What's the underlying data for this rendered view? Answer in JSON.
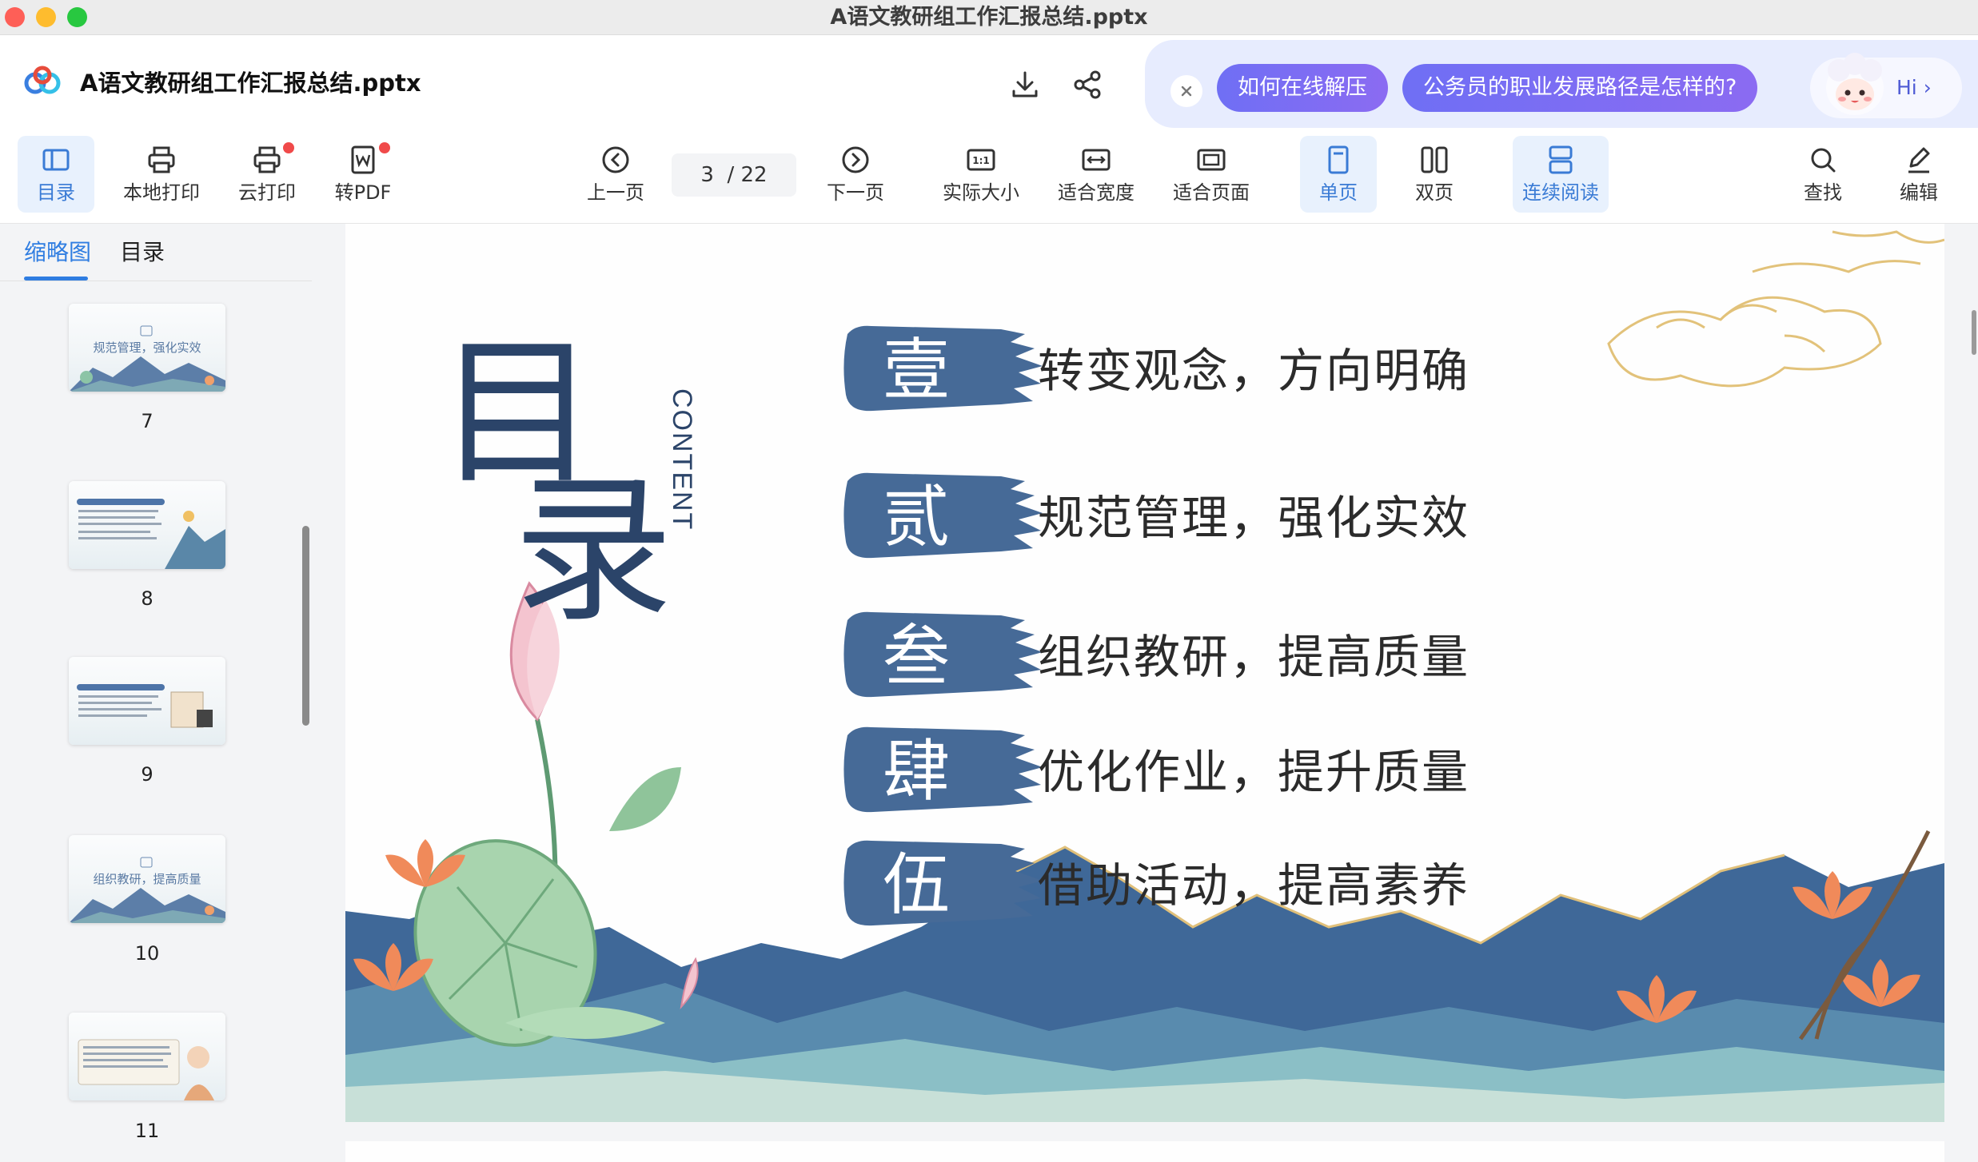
{
  "window": {
    "title": "A语文教研组工作汇报总结.pptx"
  },
  "header": {
    "doc_name": "A语文教研组工作汇报总结.pptx",
    "ai_suggestions": [
      "如何在线解压",
      "公务员的职业发展路径是怎样的?"
    ],
    "hi_label": "Hi",
    "hi_chevron": "›"
  },
  "toolbar": {
    "toc": "目录",
    "local_print": "本地打印",
    "cloud_print": "云打印",
    "to_pdf": "转PDF",
    "prev_page": "上一页",
    "page_current": "3",
    "page_total": "22",
    "page_separator": "/",
    "next_page": "下一页",
    "actual_size": "实际大小",
    "fit_width": "适合宽度",
    "fit_page": "适合页面",
    "single_page": "单页",
    "double_page": "双页",
    "continuous": "连续阅读",
    "search": "查找",
    "edit": "编辑"
  },
  "sidebar": {
    "tabs": [
      "缩略图",
      "目录"
    ],
    "thumbnails": [
      {
        "page": "7",
        "caption": "规范管理，强化实效"
      },
      {
        "page": "8",
        "caption": ""
      },
      {
        "page": "9",
        "caption": ""
      },
      {
        "page": "10",
        "caption": "组织教研，提高质量"
      },
      {
        "page": "11",
        "caption": ""
      }
    ]
  },
  "slide": {
    "title_chars": [
      "目",
      "录"
    ],
    "title_en": "CONTENT",
    "items": [
      {
        "num": "壹",
        "text": "转变观念，方向明确"
      },
      {
        "num": "贰",
        "text": "规范管理，强化实效"
      },
      {
        "num": "叁",
        "text": "组织教研，提高质量"
      },
      {
        "num": "肆",
        "text": "优化作业，提升质量"
      },
      {
        "num": "伍",
        "text": "借助活动，提高素养"
      }
    ]
  },
  "colors": {
    "accent": "#2f7de1",
    "brush_blue": "#466a97",
    "title_navy": "#2b4469",
    "ai_pill": "#7b6df3"
  }
}
